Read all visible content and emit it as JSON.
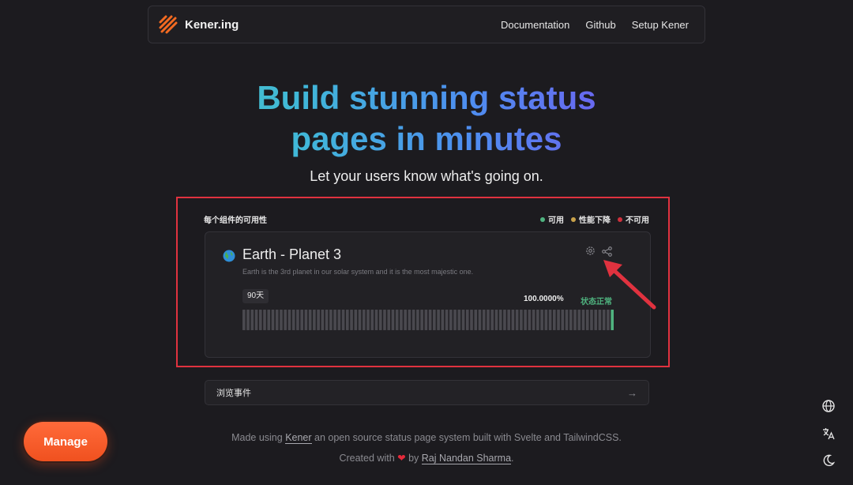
{
  "nav": {
    "brand": "Kener.ing",
    "links": [
      "Documentation",
      "Github",
      "Setup Kener"
    ]
  },
  "hero": {
    "title_line1_a": "Build ",
    "title_line1_b": "stunning status",
    "title_line2": "pages in minutes",
    "subtitle": "Let your users know what's going on."
  },
  "section": {
    "title": "每个组件的可用性",
    "legend": [
      {
        "label": "可用",
        "color": "#4fb37f"
      },
      {
        "label": "性能下降",
        "color": "#c9a24a"
      },
      {
        "label": "不可用",
        "color": "#d0303c"
      }
    ]
  },
  "monitor": {
    "name": "Earth - Planet 3",
    "description": "Earth is the 3rd planet in our solar system and it is the most majestic one.",
    "range": "90天",
    "uptime": "100.0000%",
    "state": "状态正常",
    "days_total": 90,
    "days_with_data": 1,
    "icons": [
      "globe-icon",
      "gear-icon",
      "share-icon"
    ],
    "colors": {
      "no_data": "#4a494f",
      "up": "#4fb37f"
    }
  },
  "events_link": {
    "label": "浏览事件",
    "arrow": "→"
  },
  "footer": {
    "line1_pre": "Made using ",
    "line1_link": "Kener",
    "line1_post": " an open source status page system built with Svelte and TailwindCSS.",
    "line2_pre": "Created with ",
    "heart": "❤",
    "line2_mid": " by ",
    "line2_link": "Raj Nandan Sharma",
    "line2_post": "."
  },
  "manage_button": "Manage",
  "side_icons": [
    "globe-icon",
    "translate-icon",
    "moon-icon"
  ],
  "annotation": {
    "frame_color": "#e0323f",
    "arrow_color": "#e0323f"
  }
}
